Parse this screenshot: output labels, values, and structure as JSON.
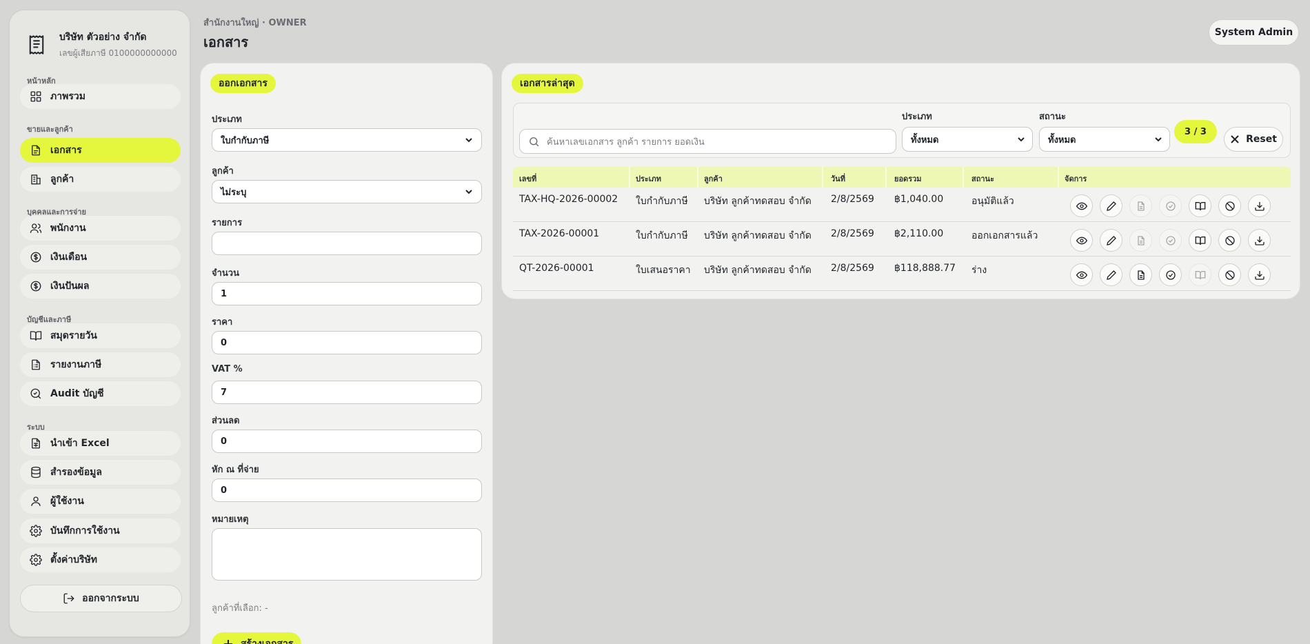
{
  "sidebar": {
    "brand_name": "บริษัท ตัวอย่าง จำกัด",
    "brand_tax": "เลขผู้เสียภาษี 0100000000000",
    "sections": [
      "หน้าหลัก",
      "ขายและลูกค้า",
      "บุคคลและการจ่าย",
      "บัญชีและภาษี",
      "ระบบ"
    ],
    "items": [
      {
        "label": "ภาพรวม",
        "icon": "grid-icon"
      },
      {
        "label": "เอกสาร",
        "icon": "document-icon",
        "active": true
      },
      {
        "label": "ลูกค้า",
        "icon": "building-icon"
      },
      {
        "label": "พนักงาน",
        "icon": "users-icon"
      },
      {
        "label": "เงินเดือน",
        "icon": "dollar-circle-icon"
      },
      {
        "label": "เงินปันผล",
        "icon": "dollar-circle-icon"
      },
      {
        "label": "สมุดรายวัน",
        "icon": "book-icon"
      },
      {
        "label": "รายงานภาษี",
        "icon": "report-icon"
      },
      {
        "label": "Audit บัญชี",
        "icon": "search-check-icon"
      },
      {
        "label": "นำเข้า Excel",
        "icon": "sheet-icon"
      },
      {
        "label": "สำรองข้อมูล",
        "icon": "database-icon"
      },
      {
        "label": "ผู้ใช้งาน",
        "icon": "user-icon"
      },
      {
        "label": "บันทึกการใช้งาน",
        "icon": "gear-icon"
      },
      {
        "label": "ตั้งค่าบริษัท",
        "icon": "gear-icon"
      }
    ],
    "logout_label": "ออกจากระบบ"
  },
  "header": {
    "breadcrumb": "สำนักงานใหญ่ · OWNER",
    "title": "เอกสาร",
    "user": "System Admin"
  },
  "form": {
    "pill": "ออกเอกสาร",
    "type_label": "ประเภท",
    "type_value": "ใบกำกับภาษี",
    "customer_label": "ลูกค้า",
    "customer_value": "ไม่ระบุ",
    "item_label": "รายการ",
    "item_value": "",
    "qty_label": "จำนวน",
    "qty_value": "1",
    "price_label": "ราคา",
    "price_value": "0",
    "vat_label": "VAT %",
    "vat_value": "7",
    "discount_label": "ส่วนลด",
    "discount_value": "0",
    "wht_label": "หัก ณ ที่จ่าย",
    "wht_value": "0",
    "note_label": "หมายเหตุ",
    "note_value": "",
    "selected_customer": "ลูกค้าที่เลือก: -",
    "create_label": "สร้างเอกสาร"
  },
  "list": {
    "pill": "เอกสารล่าสุด",
    "search_placeholder": "ค้นหาเลขเอกสาร ลูกค้า รายการ ยอดเงิน",
    "type_filter_label": "ประเภท",
    "type_filter_value": "ทั้งหมด",
    "status_filter_label": "สถานะ",
    "status_filter_value": "ทั้งหมด",
    "count": "3 / 3",
    "reset_label": "Reset",
    "columns": [
      "เลขที่",
      "ประเภท",
      "ลูกค้า",
      "วันที่",
      "ยอดรวม",
      "สถานะ",
      "จัดการ"
    ],
    "rows": [
      {
        "no": "TAX-HQ-2026-00002",
        "type": "ใบกำกับภาษี",
        "customer": "บริษัท ลูกค้าทดสอบ จำกัด",
        "date": "2/8/2569",
        "total": "฿1,040.00",
        "status": "อนุมัติแล้ว"
      },
      {
        "no": "TAX-2026-00001",
        "type": "ใบกำกับภาษี",
        "customer": "บริษัท ลูกค้าทดสอบ จำกัด",
        "date": "2/8/2569",
        "total": "฿2,110.00",
        "status": "ออกเอกสารแล้ว"
      },
      {
        "no": "QT-2026-00001",
        "type": "ใบเสนอราคา",
        "customer": "บริษัท ลูกค้าทดสอบ จำกัด",
        "date": "2/8/2569",
        "total": "฿118,888.77",
        "status": "ร่าง"
      }
    ]
  },
  "colors": {
    "accent": "#e4f73c",
    "background": "#d6d6d4",
    "panel": "#f2f2f0",
    "table_header": "#eef7b4"
  }
}
